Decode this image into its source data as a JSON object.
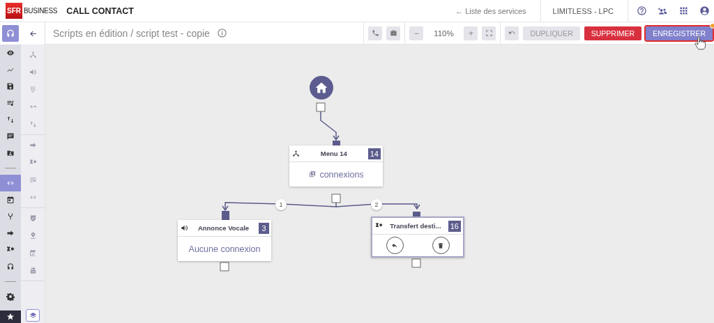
{
  "header": {
    "brand": "SFR",
    "brand_suffix": "BUSINESS",
    "app_title": "CALL CONTACT",
    "services_link": "← Liste des services",
    "account": "LIMITLESS - LPC"
  },
  "main_nav": [
    {
      "selected": true
    },
    {
      "selected": false
    },
    {
      "selected": false
    },
    {
      "selected": false
    },
    {
      "selected": false
    },
    {
      "selected": false
    },
    {
      "selected": false
    },
    {
      "selected": false
    },
    {
      "selected": true
    },
    {
      "selected": false
    },
    {
      "selected": false
    },
    {
      "selected": false
    },
    {
      "selected": false
    },
    {
      "selected": false
    },
    {
      "selected": false
    },
    {
      "selected": true
    }
  ],
  "title_bar": {
    "breadcrumb": "Scripts en édition / script test - copie"
  },
  "toolbar": {
    "zoom": "110%",
    "zoom_out": "−",
    "zoom_in": "+",
    "buttons": [
      {
        "kind": "neutral",
        "label": "DUPLIQUER",
        "disabled": true
      },
      {
        "kind": "danger",
        "label": "SUPPRIMER",
        "disabled": false
      },
      {
        "kind": "primary",
        "label": "ENREGISTRER",
        "disabled": false,
        "focused": true,
        "notification": true
      }
    ]
  },
  "nodes": [
    {
      "kind": "connections",
      "title": "Menu 14",
      "badge": "14",
      "body": "connexions",
      "selected": false
    },
    {
      "kind": "text",
      "title": "Annonce Vocale",
      "badge": "3",
      "body": "Aucune connexion",
      "selected": false
    },
    {
      "kind": "actions",
      "title": "Transfert desti...",
      "badge": "16",
      "selected": true
    }
  ],
  "connections": [
    {
      "label": "1"
    },
    {
      "label": "2"
    }
  ]
}
